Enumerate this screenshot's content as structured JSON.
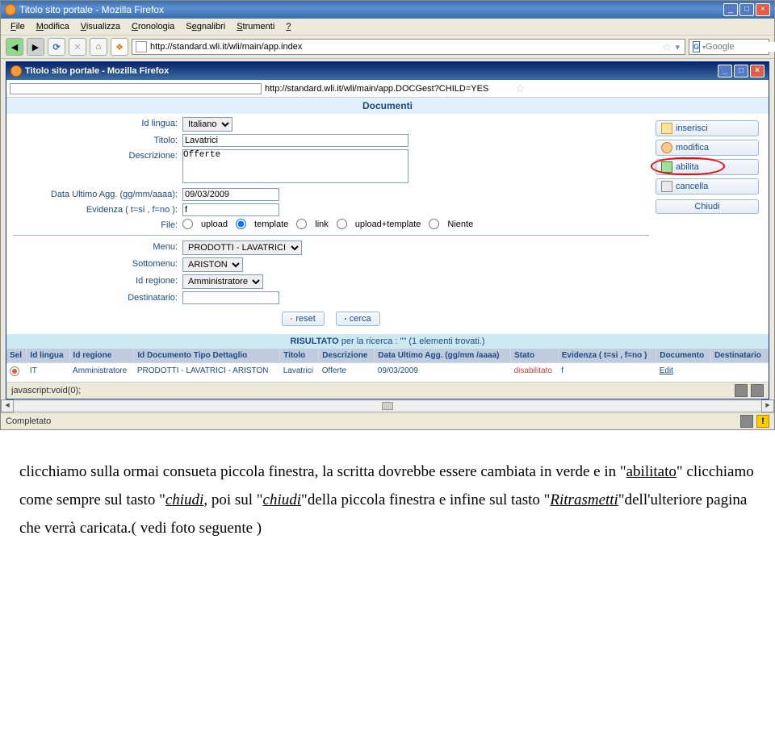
{
  "outer": {
    "title": "Titolo sito portale - Mozilla Firefox",
    "menu": [
      "File",
      "Modifica",
      "Visualizza",
      "Cronologia",
      "Segnalibri",
      "Strumenti",
      "?"
    ],
    "url": "http://standard.wli.it/wli/main/app.index",
    "search_placeholder": "Google",
    "status": "Completato"
  },
  "inner": {
    "title": "Titolo sito portale - Mozilla Firefox",
    "url": "http://standard.wli.it/wli/main/app.DOCGest?CHILD=YES",
    "section_title": "Documenti",
    "status": "javascript:void(0);"
  },
  "form": {
    "labels": {
      "id_lingua": "Id lingua:",
      "titolo": "Titolo:",
      "descrizione": "Descrizione:",
      "data_agg": "Data Ultimo Agg. (gg/mm/aaaa):",
      "evidenza": "Evidenza ( t=si , f=no ):",
      "file": "File:",
      "menu": "Menu:",
      "sottomenu": "Sottomenu:",
      "id_regione": "Id regione:",
      "destinatario": "Destinatario:"
    },
    "values": {
      "id_lingua": "Italiano",
      "titolo": "Lavatrici",
      "descrizione": "Offerte",
      "data_agg": "09/03/2009",
      "evidenza": "f",
      "menu": "PRODOTTI - LAVATRICI",
      "sottomenu": "ARISTON",
      "id_regione": "Amministratore",
      "destinatario": ""
    },
    "radios": {
      "upload": "upload",
      "template": "template",
      "link": "link",
      "upload_template": "upload+template",
      "niente": "Niente"
    }
  },
  "sidebuttons": {
    "inserisci": "inserisci",
    "modifica": "modifica",
    "abilita": "abilita",
    "cancella": "cancella",
    "chiudi": "Chiudi"
  },
  "centerbuttons": {
    "reset": "reset",
    "cerca": "cerca"
  },
  "result": {
    "header_bold": "RISULTATO",
    "header_rest": " per la ricerca : \"\" (1 elementi trovati.)"
  },
  "table": {
    "cols": {
      "sel": "Sel",
      "id_lingua": "Id lingua",
      "id_regione": "Id regione",
      "id_doc": "Id Documento Tipo Dettaglio",
      "titolo": "Titolo",
      "descrizione": "Descrizione",
      "data": "Data Ultimo Agg. (gg/mm /aaaa)",
      "stato": "Stato",
      "evidenza": "Evidenza ( t=si , f=no )",
      "documento": "Documento",
      "destinatario": "Destinatario"
    },
    "row": {
      "id_lingua": "IT",
      "id_regione": "Amministratore",
      "id_doc": "PRODOTTI - LAVATRICI - ARISTON",
      "titolo": "Lavatrici",
      "descrizione": "Offerte",
      "data": "09/03/2009",
      "stato": "disabilitato",
      "evidenza": "f",
      "documento": "Edit",
      "destinatario": ""
    }
  },
  "doc_text": {
    "p1a": "clicchiamo sulla ormai consueta piccola finestra, la scritta dovrebbe essere cambiata in ",
    "p1b": "verde",
    "p1c": " e in \"",
    "p1d": "abilitato",
    "p1e": "\" clicchiamo come sempre sul tasto \"",
    "p1f": "chiudi",
    "p1g": ", poi sul \"",
    "p1h": "chiudi",
    "p1i": "\"",
    "p1j": "della piccola finestra e infine sul tasto \"",
    "p1k": "Ritrasmetti",
    "p1l": "\"",
    "p1m": "dell'ulteriore pagina che verrà caricata.( vedi foto seguente )"
  }
}
